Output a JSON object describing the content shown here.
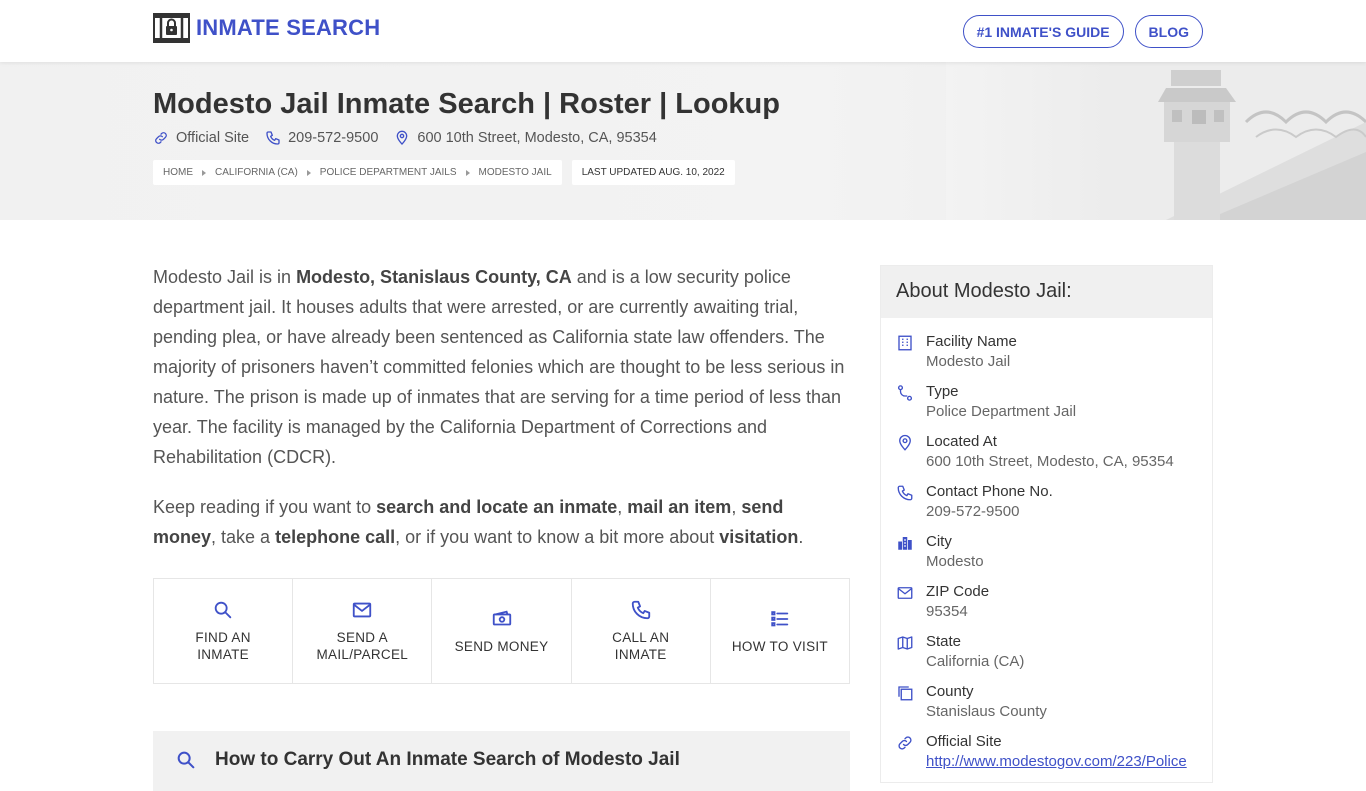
{
  "brand": {
    "name": "INMATE SEARCH",
    "accent": "#3f51c8"
  },
  "nav": {
    "guide_label": "#1 INMATE'S GUIDE",
    "blog_label": "BLOG"
  },
  "hero": {
    "title": "Modesto Jail Inmate Search | Roster | Lookup",
    "official_site": "Official Site",
    "phone": "209-572-9500",
    "address": "600 10th Street, Modesto, CA, 95354",
    "breadcrumbs": [
      "HOME",
      "CALIFORNIA (CA)",
      "POLICE DEPARTMENT JAILS",
      "MODESTO JAIL"
    ],
    "last_updated": "LAST UPDATED AUG. 10, 2022"
  },
  "intro": {
    "p1_a": "Modesto Jail is in ",
    "p1_b": "Modesto, Stanislaus County, CA",
    "p1_c": " and is a low security police department jail. It houses adults that were arrested, or are currently awaiting trial, pending plea, or have already been sentenced as California state law offenders. The majority of prisoners haven’t committed felonies which are thought to be less serious in nature. The prison is made up of inmates that are serving for a time period of less than year. The facility is managed by the California Department of Corrections and Rehabilitation (CDCR).",
    "p2_a": "Keep reading if you want to ",
    "p2_b": "search and locate an inmate",
    "p2_c": ", ",
    "p2_d": "mail an item",
    "p2_e": ", ",
    "p2_f": "send money",
    "p2_g": ", take a ",
    "p2_h": "telephone call",
    "p2_i": ", or if you want to know a bit more about ",
    "p2_j": "visitation",
    "p2_k": "."
  },
  "actions": [
    {
      "line1": "FIND AN",
      "line2": "INMATE",
      "icon": "search-icon"
    },
    {
      "line1": "SEND A",
      "line2": "MAIL/PARCEL",
      "icon": "mail-icon"
    },
    {
      "line1": "SEND MONEY",
      "line2": "",
      "icon": "money-icon"
    },
    {
      "line1": "CALL AN",
      "line2": "INMATE",
      "icon": "phone-icon"
    },
    {
      "line1": "HOW TO VISIT",
      "line2": "",
      "icon": "list-icon"
    }
  ],
  "howto": {
    "title": "How to Carry Out An Inmate Search of Modesto Jail"
  },
  "about": {
    "heading": "About Modesto Jail:",
    "rows": [
      {
        "label": "Facility Name",
        "value": "Modesto Jail",
        "icon": "building-icon"
      },
      {
        "label": "Type",
        "value": "Police Department Jail",
        "icon": "route-icon"
      },
      {
        "label": "Located At",
        "value": "600 10th Street, Modesto, CA, 95354",
        "icon": "map-pin-icon"
      },
      {
        "label": "Contact Phone No.",
        "value": "209-572-9500",
        "icon": "phone-icon"
      },
      {
        "label": "City",
        "value": "Modesto",
        "icon": "city-icon"
      },
      {
        "label": "ZIP Code",
        "value": "95354",
        "icon": "envelope-icon"
      },
      {
        "label": "State",
        "value": "California (CA)",
        "icon": "map-icon"
      },
      {
        "label": "County",
        "value": "Stanislaus County",
        "icon": "copy-icon"
      },
      {
        "label": "Official Site",
        "value": "http://www.modestogov.com/223/Police",
        "icon": "link-icon"
      }
    ]
  }
}
